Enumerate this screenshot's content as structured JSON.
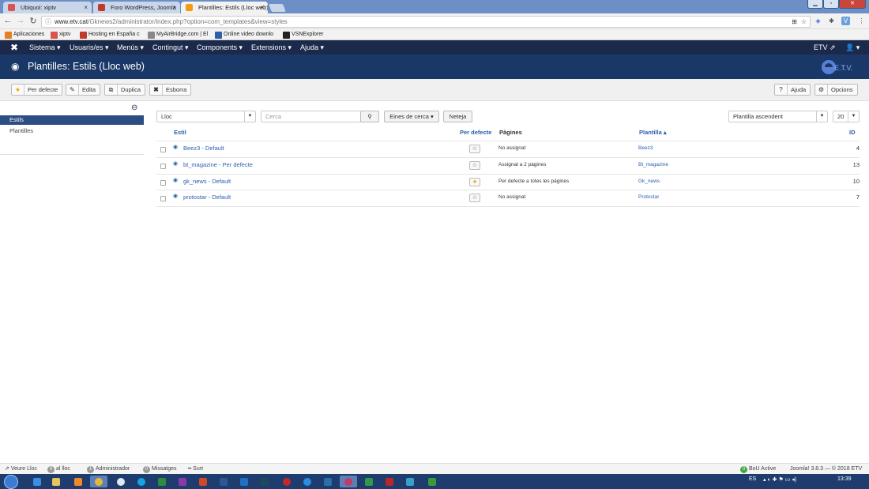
{
  "browser": {
    "tabs": [
      {
        "title": "Ubiquoi: xiptv",
        "fav": "#d9534f"
      },
      {
        "title": "Foro WordPress, Joomla",
        "fav": "#c0392b"
      },
      {
        "title": "Plantilles: Estils (Lloc web)",
        "fav": "#f39c12"
      }
    ],
    "close_glyph": "×",
    "url_host": "www.etv.cat",
    "url_path": "/Gknews2/administrator/index.php?option=com_templates&view=styles",
    "bookmarks": [
      {
        "label": "Aplicaciones",
        "color": "#e67e22"
      },
      {
        "label": "xiptv",
        "color": "#d9534f"
      },
      {
        "label": "Hosting en España c",
        "color": "#c0392b"
      },
      {
        "label": "MyAirBridge.com | El",
        "color": "#888888"
      },
      {
        "label": "Online video downlo",
        "color": "#2e5fa8"
      },
      {
        "label": "VSNExplorer",
        "color": "#222222"
      }
    ]
  },
  "joomla": {
    "menu": [
      "Sistema ▾",
      "Usuaris/es ▾",
      "Menús ▾",
      "Contingut ▾",
      "Components ▾",
      "Extensions ▾",
      "Ajuda ▾"
    ],
    "right_user": "ETV",
    "page_title": "Plantilles: Estils (Lloc web)",
    "brand_text": "E.T.V.",
    "toolbar": {
      "default": "Per defecte",
      "edit": "Edita",
      "duplicate": "Duplica",
      "delete": "Esborra",
      "help": "Ajuda",
      "options": "Opcions"
    },
    "sidebar": {
      "active": "Estils",
      "other": "Plantilles"
    },
    "filters": {
      "location": "Lloc",
      "search_placeholder": "Cerca",
      "search_tools": "Eines de cerca ▾",
      "clear": "Neteja",
      "ordering": "Plantilla ascendent",
      "limit": "20"
    },
    "columns": {
      "style": "Estil",
      "default": "Per defecte",
      "pages": "Pàgines",
      "template": "Plantilla ▴",
      "id": "ID"
    },
    "rows": [
      {
        "style": "Beez3 - Default",
        "is_default": false,
        "pages": "No assignat",
        "template": "Beez3",
        "id": "4"
      },
      {
        "style": "bt_magazine - Per defecte",
        "is_default": false,
        "pages": "Assignat a 2 pàgines",
        "template": "Bt_magazine",
        "id": "13"
      },
      {
        "style": "gk_news - Default",
        "is_default": true,
        "pages": "Per defecte a totes les pàgines",
        "template": "Gk_news",
        "id": "10"
      },
      {
        "style": "protostar - Default",
        "is_default": false,
        "pages": "No assignat",
        "template": "Protostar",
        "id": "7"
      }
    ],
    "status": {
      "view_site": "Veure Lloc",
      "online_count": "0",
      "online_label": "al lloc",
      "admin_count": "1",
      "admin_label": "Administrador",
      "msg_count": "0",
      "msg_label": "Missatges",
      "logout": "Surt",
      "bou_count": "0",
      "bou_label": "BoU Active",
      "version": "Joomla! 3.8.3 — © 2018 ETV"
    }
  },
  "taskbar": {
    "lang": "ES",
    "time": "13:39"
  }
}
